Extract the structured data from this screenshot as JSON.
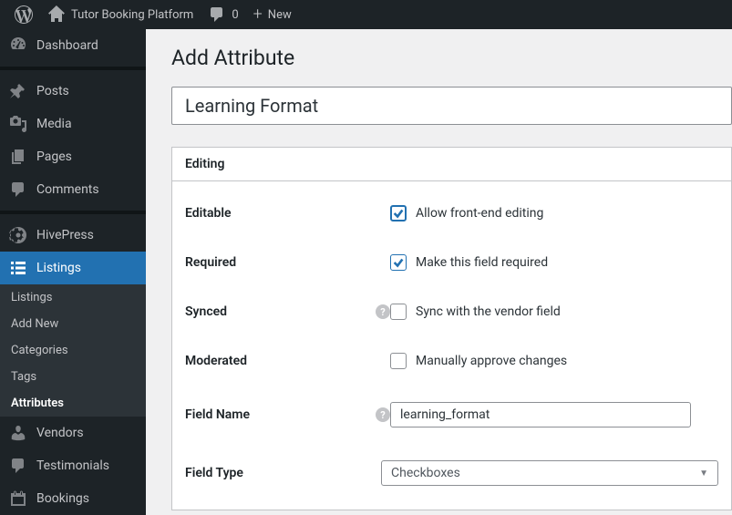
{
  "toolbar": {
    "site_name": "Tutor Booking Platform",
    "comments_count": "0",
    "new_label": "New"
  },
  "sidebar": {
    "dashboard": "Dashboard",
    "posts": "Posts",
    "media": "Media",
    "pages": "Pages",
    "comments": "Comments",
    "hivepress": "HivePress",
    "listings": "Listings",
    "vendors": "Vendors",
    "testimonials": "Testimonials",
    "bookings": "Bookings"
  },
  "submenu": {
    "listings": "Listings",
    "add_new": "Add New",
    "categories": "Categories",
    "tags": "Tags",
    "attributes": "Attributes"
  },
  "page": {
    "title": "Add Attribute",
    "title_input_value": "Learning Format"
  },
  "panel": {
    "header": "Editing",
    "rows": {
      "editable": {
        "label": "Editable",
        "text": "Allow front-end editing",
        "checked": true
      },
      "required": {
        "label": "Required",
        "text": "Make this field required",
        "checked": true
      },
      "synced": {
        "label": "Synced",
        "text": "Sync with the vendor field",
        "checked": false,
        "help": true
      },
      "moderated": {
        "label": "Moderated",
        "text": "Manually approve changes",
        "checked": false
      },
      "field_name": {
        "label": "Field Name",
        "value": "learning_format",
        "help": true
      },
      "field_type": {
        "label": "Field Type",
        "value": "Checkboxes"
      }
    }
  }
}
